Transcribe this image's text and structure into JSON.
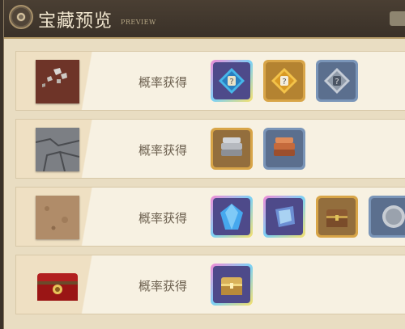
{
  "header": {
    "title": "宝藏预览",
    "subtitle": "PREVIEW"
  },
  "rows": [
    {
      "tile": "red-dirt-block-icon",
      "label": "概率获得",
      "items": [
        "puzzle-piece-rainbow-icon",
        "puzzle-piece-gold-icon",
        "puzzle-piece-silver-icon"
      ]
    },
    {
      "tile": "gray-stone-block-icon",
      "label": "概率获得",
      "items": [
        "silver-ingot-stack-icon",
        "copper-ingot-stack-icon"
      ]
    },
    {
      "tile": "sandstone-block-icon",
      "label": "概率获得",
      "items": [
        "blue-crystal-icon",
        "crystal-shard-icon",
        "wooden-treasure-chest-icon",
        "silver-coin-icon"
      ]
    },
    {
      "tile": "red-treasure-chest-icon",
      "label": "概率获得",
      "items": [
        "golden-treasure-chest-icon"
      ]
    }
  ],
  "colors": {
    "header_bg": "#3a3128",
    "panel_bg": "#e9ddc2",
    "row_bg": "#f7f1e2",
    "label": "#6c604f"
  }
}
